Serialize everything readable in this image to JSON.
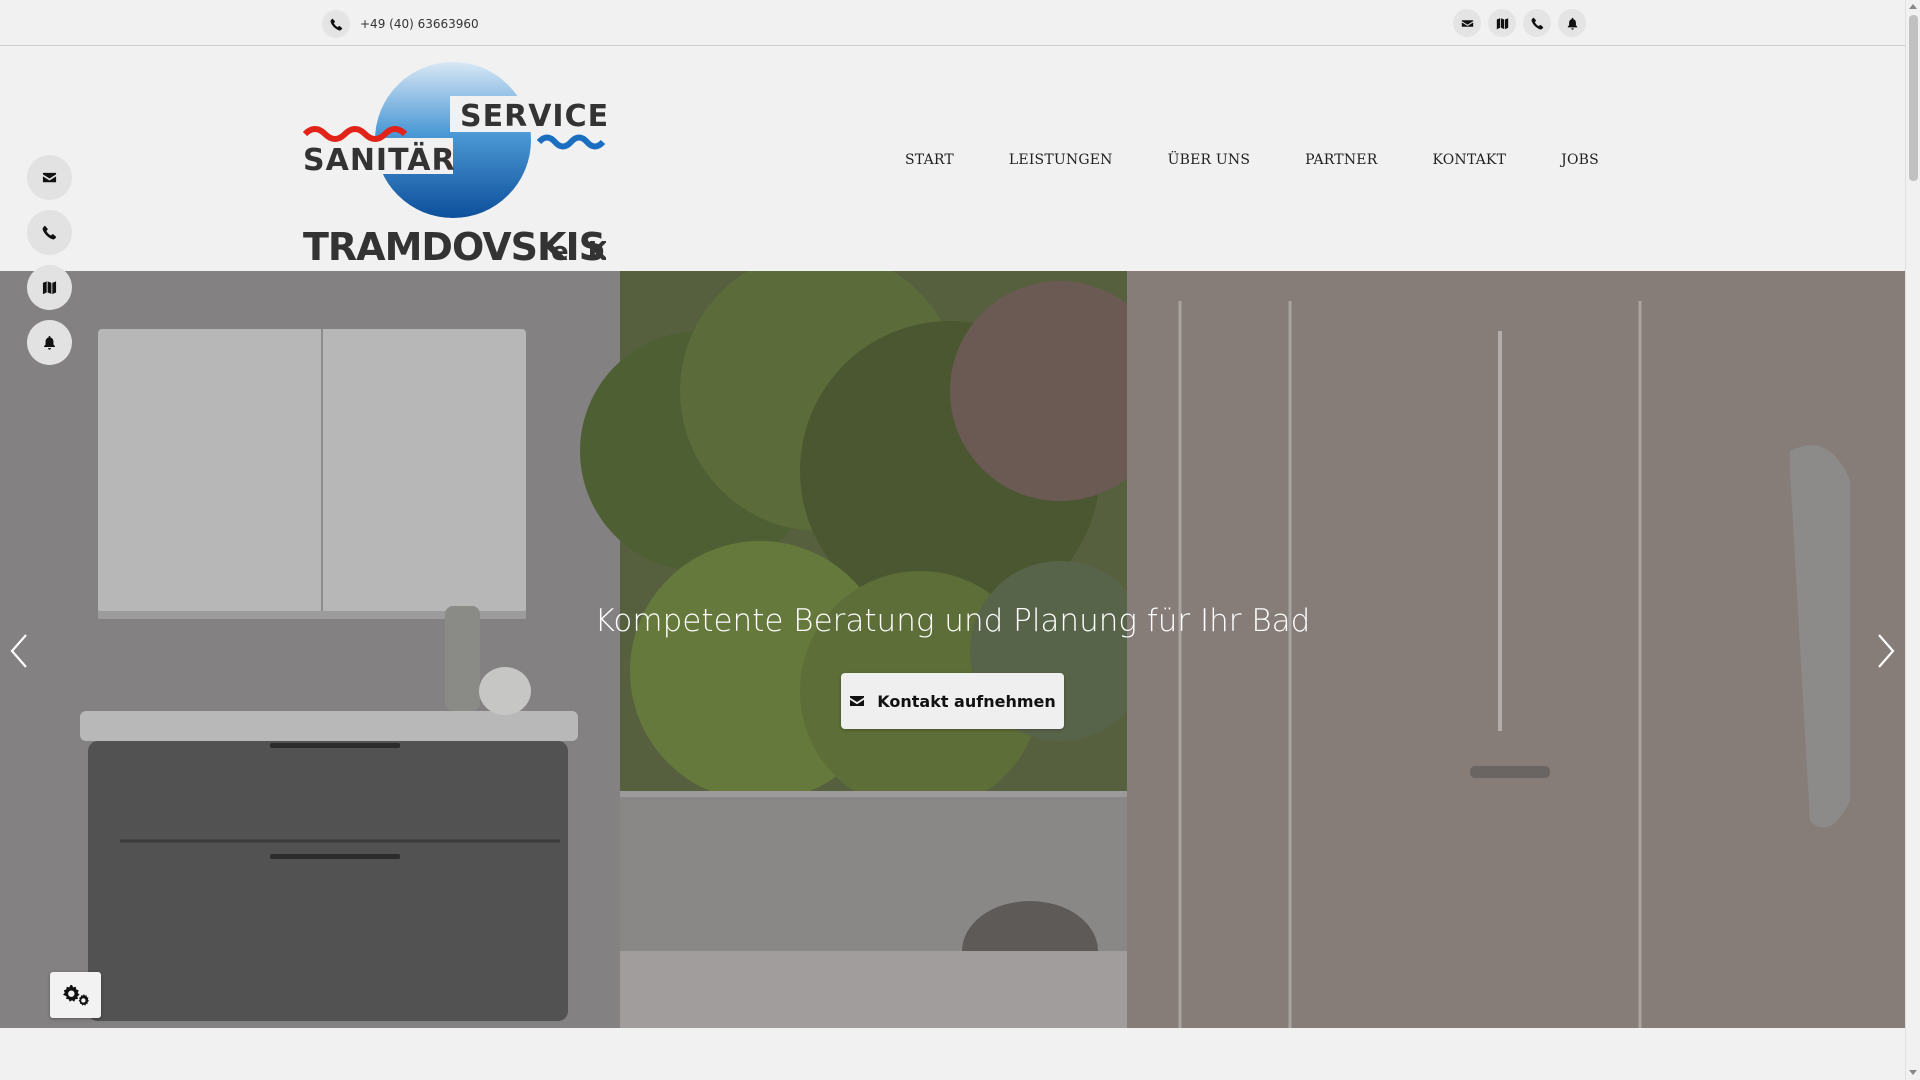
{
  "topbar": {
    "phone_number": "+49 (40) 63663960",
    "icons": [
      "envelope-icon",
      "map-icon",
      "phone-icon",
      "bell-icon"
    ]
  },
  "brand": {
    "logo_word_service": "SERVICE",
    "logo_word_sanitaer": "SANITÄR",
    "logo_company": "TRAMDOVSKIS",
    "logo_suffix": "e. K.",
    "colors": {
      "red": "#e2231a",
      "blue": "#1a6fc0",
      "dark": "#333333"
    }
  },
  "nav": {
    "items": [
      "START",
      "LEISTUNGEN",
      "ÜBER UNS",
      "PARTNER",
      "KONTAKT",
      "JOBS"
    ]
  },
  "hero": {
    "title": "Kompetente Beratung und Planung für Ihr Bad",
    "cta_label": "Kontakt aufnehmen",
    "cta_icon": "envelope-icon"
  },
  "side_buttons": [
    "envelope-icon",
    "phone-icon",
    "map-icon",
    "bell-icon"
  ],
  "settings_button_icon": "gears-icon"
}
